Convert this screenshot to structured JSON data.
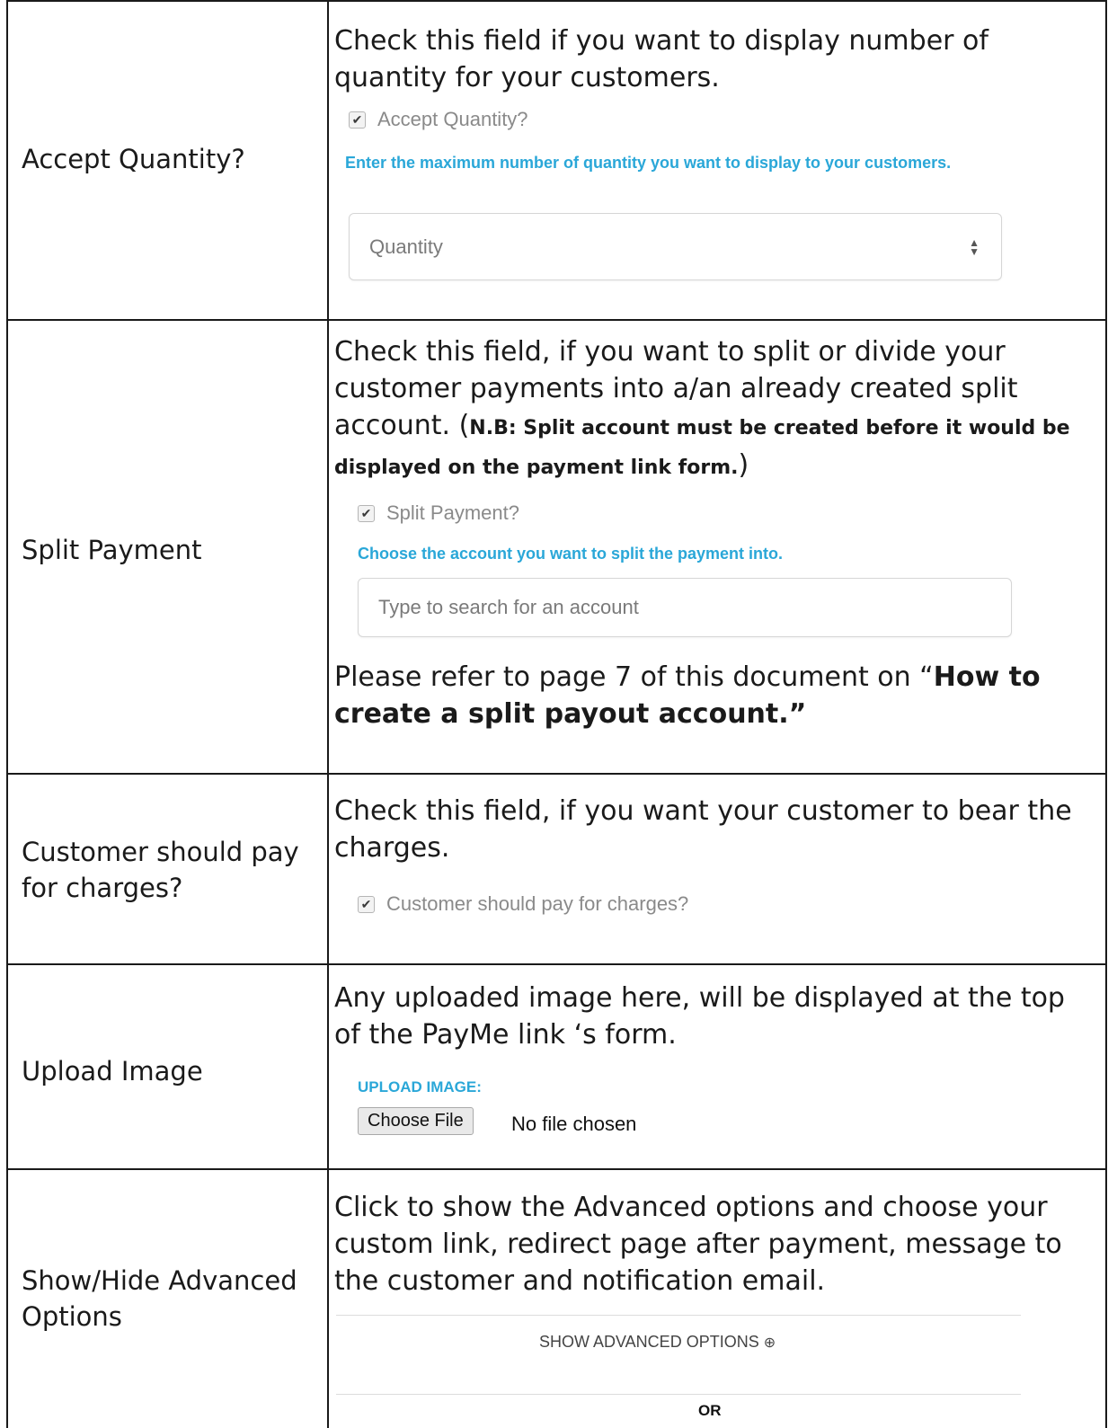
{
  "rows": [
    {
      "label": "Accept Quantity?",
      "description": "Check this field if you want to display number of quantity for your customers.",
      "checkbox_label": "Accept Quantity?",
      "hint": "Enter the maximum number of quantity you want to display to your customers.",
      "input_placeholder": "Quantity"
    },
    {
      "label": "Split Payment",
      "description_main": "Check this field, if you want to split or divide your customer payments into a/an already created split account. (",
      "description_note": "N.B: Split account must be created before it would be displayed on the payment link form.",
      "description_close": ")",
      "checkbox_label": "Split Payment?",
      "hint": "Choose the account you want to split the payment into.",
      "input_placeholder": "Type to search for an account",
      "refer_prefix": "Please refer to page 7 of this document on “",
      "refer_bold": "How to create a split payout account.”"
    },
    {
      "label": "Customer should pay for charges?",
      "description": "Check this field, if you want your customer to bear the charges.",
      "checkbox_label": "Customer should pay for charges?"
    },
    {
      "label": "Upload Image",
      "description": "Any uploaded image here, will be displayed at the top of the PayMe link ‘s form.",
      "upload_heading": "UPLOAD IMAGE:",
      "file_button": "Choose File",
      "file_status": "No file chosen"
    },
    {
      "label": "Show/Hide Advanced Options",
      "description": "Click to show the Advanced options and choose your custom link, redirect page after payment, message to the customer and notification email.",
      "advanced_button": "SHOW ADVANCED OPTIONS",
      "advanced_icon": "circle-arrow-down-icon",
      "or_text": "OR"
    }
  ],
  "colors": {
    "hint_blue": "#2aa7d8",
    "border": "#1a1a1a",
    "muted_text": "#8a8a8a"
  }
}
